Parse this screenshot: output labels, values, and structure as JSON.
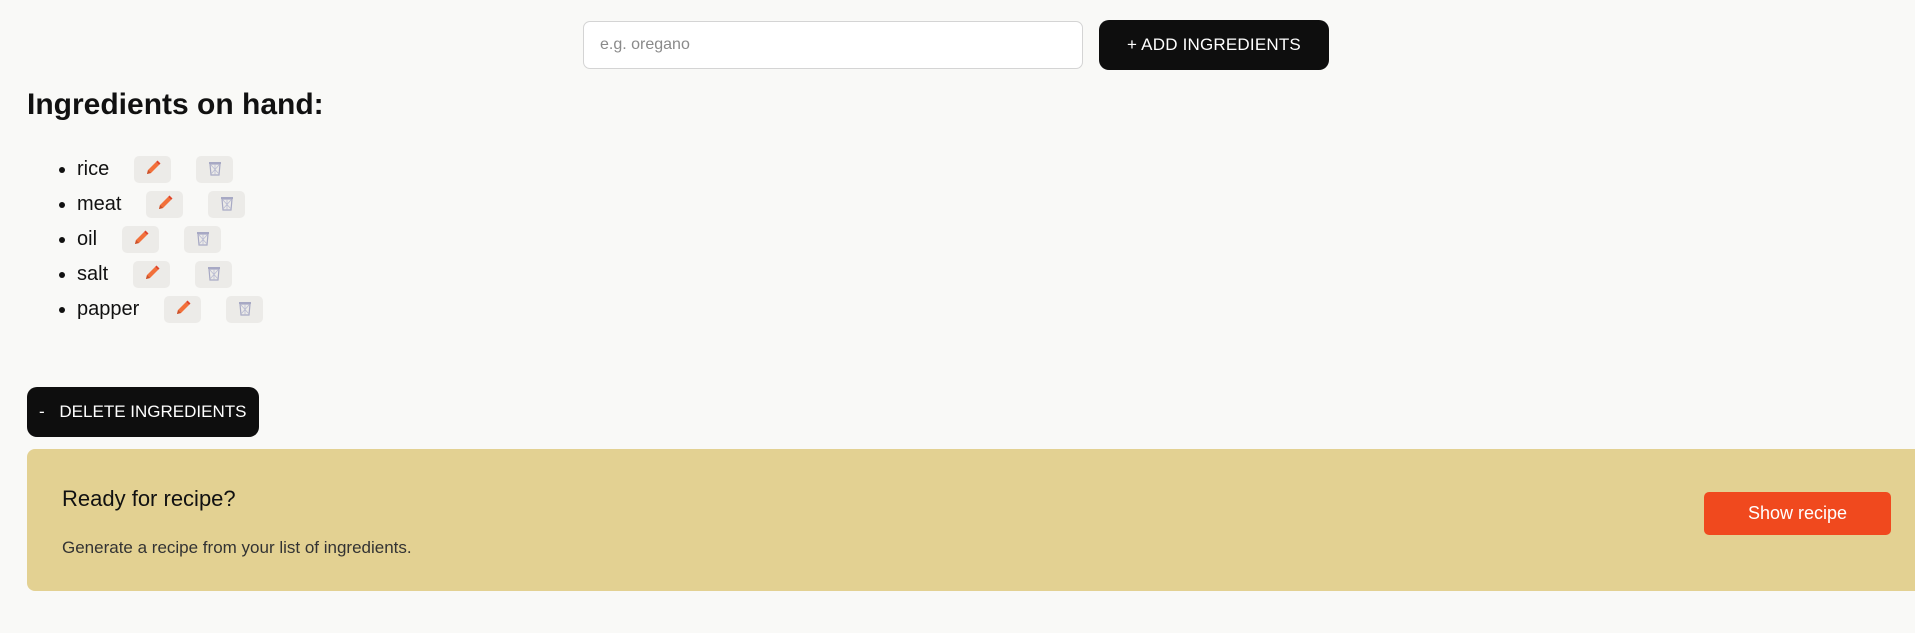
{
  "form": {
    "placeholder": "e.g. oregano",
    "value": "",
    "add_plus": "+",
    "add_label": "ADD INGREDIENTS"
  },
  "ingredients_heading": "Ingredients on hand:",
  "ingredients": [
    {
      "name": "rice"
    },
    {
      "name": "meat"
    },
    {
      "name": "oil"
    },
    {
      "name": "salt"
    },
    {
      "name": "papper"
    }
  ],
  "icons": {
    "edit": "pencil-icon",
    "delete": "trash-icon"
  },
  "delete_button": {
    "minus": "-",
    "label": "DELETE INGREDIENTS"
  },
  "recipe_card": {
    "title": "Ready for recipe?",
    "description": "Generate a recipe from your list of ingredients.",
    "button_label": "Show recipe"
  },
  "colors": {
    "accent": "#f0491e",
    "card_background": "#e3d192",
    "dark_button": "#0e0e0e",
    "pencil": "#f2703a"
  }
}
